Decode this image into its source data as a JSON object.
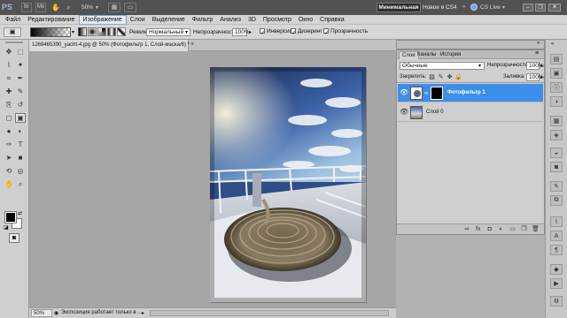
{
  "app": {
    "logo": "PS",
    "zoom": "50%",
    "workspace_minimal": "Минимальная",
    "workspace_new_cs4": "Новое в CS4",
    "cs_live": "CS Live"
  },
  "menu": [
    "Файл",
    "Редактирование",
    "Изображение",
    "Слои",
    "Выделение",
    "Фильтр",
    "Анализ",
    "3D",
    "Просмотр",
    "Окно",
    "Справка"
  ],
  "options": {
    "mode_label": "Режим:",
    "mode_value": "Нормальный",
    "opacity_label": "Непрозрачность:",
    "opacity_value": "100%",
    "inverse": "Инверсия",
    "dither": "Дизеринг",
    "transparency": "Прозрачность"
  },
  "document": {
    "tab_title": "1269465390_yacht-4.jpg @ 50% (Фотофильтр 1, Слой-маска/8) *",
    "status_zoom": "50%",
    "status_text": "Экспозиция работает только в ..."
  },
  "layers_panel": {
    "tabs": [
      "Слои",
      "Каналы",
      "История"
    ],
    "blend_mode": "Обычные",
    "opacity_label": "Непрозрачность:",
    "opacity_value": "100%",
    "lock_label": "Закрепить:",
    "fill_label": "Заливка:",
    "fill_value": "100%",
    "layers": [
      {
        "name": "Фотофильтр 1",
        "selected": true
      },
      {
        "name": "Слой 0",
        "selected": false
      }
    ]
  },
  "colors": {
    "selection_blue": "#3d8ee8",
    "app_bar": "#525252"
  },
  "icons": {
    "tools": [
      "move-tool-icon",
      "marquee-tool-icon",
      "lasso-tool-icon",
      "quick-select-tool-icon",
      "crop-tool-icon",
      "eyedropper-tool-icon",
      "healing-brush-tool-icon",
      "brush-tool-icon",
      "clone-stamp-tool-icon",
      "history-brush-tool-icon",
      "eraser-tool-icon",
      "gradient-tool-icon",
      "blur-tool-icon",
      "dodge-tool-icon",
      "pen-tool-icon",
      "type-tool-icon",
      "path-select-tool-icon",
      "shape-tool-icon",
      "3d-rotate-tool-icon",
      "3d-orbit-tool-icon",
      "hand-tool-icon",
      "zoom-tool-icon"
    ]
  }
}
